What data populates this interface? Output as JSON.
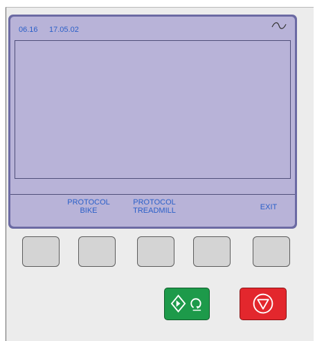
{
  "status_bar": {
    "version": "06.16",
    "date": "17.05.02",
    "power_icon": "ac-power-icon"
  },
  "softkeys": {
    "protocol_bike": "PROTOCOL\nBIKE",
    "protocol_treadmill": "PROTOCOL\nTREADMILL",
    "exit": "EXIT"
  },
  "controls": {
    "start_icon": "start-icon",
    "stop_icon": "stop-icon"
  },
  "colors": {
    "screen_background": "#b8b3d8",
    "screen_frame": "#6b6aa3",
    "text": "#2a5fc8",
    "start": "#1d9a4a",
    "stop": "#e3272d"
  }
}
